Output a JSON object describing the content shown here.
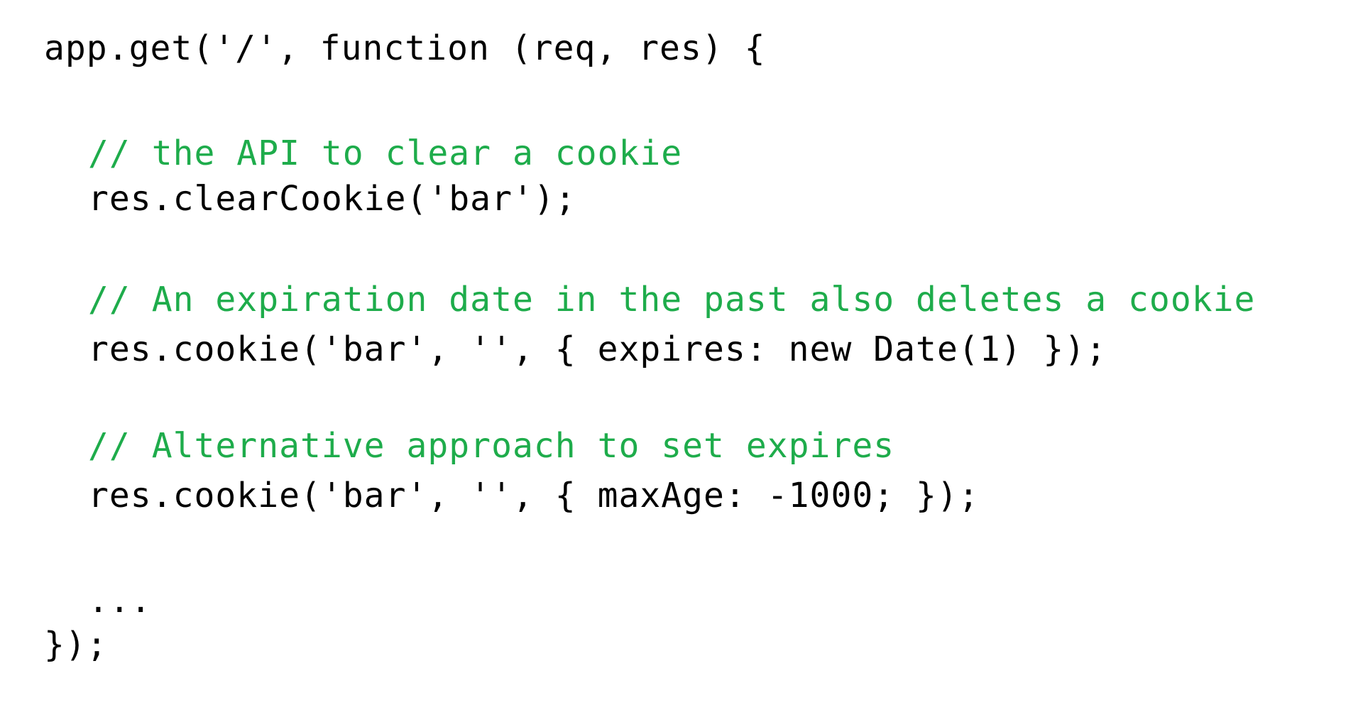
{
  "code": {
    "line1": "app.get('/', function (req, res) {",
    "comment1": "// the API to clear a cookie",
    "line2": "res.clearCookie('bar');",
    "comment2": "// An expiration date in the past also deletes a cookie",
    "line3": "res.cookie('bar', '', { expires: new Date(1) });",
    "comment3": "// Alternative approach to set expires",
    "line4": "res.cookie('bar', '', { maxAge: -1000; });",
    "ellipsis": "...",
    "closing": "});"
  },
  "colors": {
    "code_text": "#000000",
    "comment_text": "#1eac4b",
    "background": "#ffffff"
  }
}
